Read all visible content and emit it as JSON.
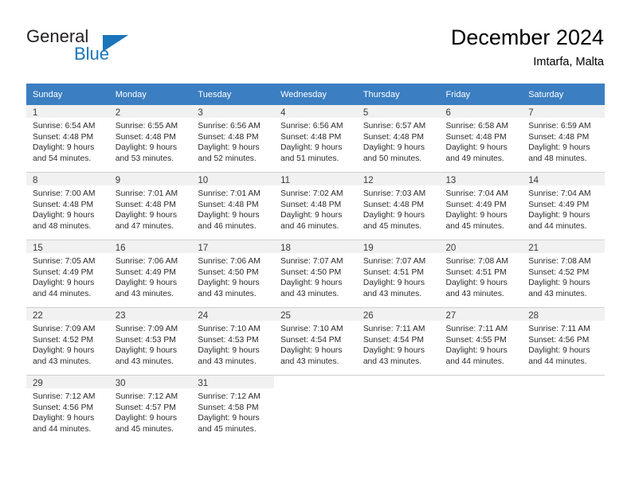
{
  "brand": {
    "name_part1": "General",
    "name_part2": "Blue",
    "triangle_icon": "triangle-icon",
    "accent_color": "#1b75bb"
  },
  "header": {
    "title": "December 2024",
    "subtitle": "Imtarfa, Malta"
  },
  "theme": {
    "header_row_color": "#3b7ec1",
    "daynum_background": "#f1f1f1",
    "grid_line_color": "#d0d0d0"
  },
  "calendar": {
    "weekday_headers": [
      "Sunday",
      "Monday",
      "Tuesday",
      "Wednesday",
      "Thursday",
      "Friday",
      "Saturday"
    ],
    "weeks": [
      [
        {
          "day": "1",
          "sunrise": "Sunrise: 6:54 AM",
          "sunset": "Sunset: 4:48 PM",
          "daylight_line1": "Daylight: 9 hours",
          "daylight_line2": "and 54 minutes."
        },
        {
          "day": "2",
          "sunrise": "Sunrise: 6:55 AM",
          "sunset": "Sunset: 4:48 PM",
          "daylight_line1": "Daylight: 9 hours",
          "daylight_line2": "and 53 minutes."
        },
        {
          "day": "3",
          "sunrise": "Sunrise: 6:56 AM",
          "sunset": "Sunset: 4:48 PM",
          "daylight_line1": "Daylight: 9 hours",
          "daylight_line2": "and 52 minutes."
        },
        {
          "day": "4",
          "sunrise": "Sunrise: 6:56 AM",
          "sunset": "Sunset: 4:48 PM",
          "daylight_line1": "Daylight: 9 hours",
          "daylight_line2": "and 51 minutes."
        },
        {
          "day": "5",
          "sunrise": "Sunrise: 6:57 AM",
          "sunset": "Sunset: 4:48 PM",
          "daylight_line1": "Daylight: 9 hours",
          "daylight_line2": "and 50 minutes."
        },
        {
          "day": "6",
          "sunrise": "Sunrise: 6:58 AM",
          "sunset": "Sunset: 4:48 PM",
          "daylight_line1": "Daylight: 9 hours",
          "daylight_line2": "and 49 minutes."
        },
        {
          "day": "7",
          "sunrise": "Sunrise: 6:59 AM",
          "sunset": "Sunset: 4:48 PM",
          "daylight_line1": "Daylight: 9 hours",
          "daylight_line2": "and 48 minutes."
        }
      ],
      [
        {
          "day": "8",
          "sunrise": "Sunrise: 7:00 AM",
          "sunset": "Sunset: 4:48 PM",
          "daylight_line1": "Daylight: 9 hours",
          "daylight_line2": "and 48 minutes."
        },
        {
          "day": "9",
          "sunrise": "Sunrise: 7:01 AM",
          "sunset": "Sunset: 4:48 PM",
          "daylight_line1": "Daylight: 9 hours",
          "daylight_line2": "and 47 minutes."
        },
        {
          "day": "10",
          "sunrise": "Sunrise: 7:01 AM",
          "sunset": "Sunset: 4:48 PM",
          "daylight_line1": "Daylight: 9 hours",
          "daylight_line2": "and 46 minutes."
        },
        {
          "day": "11",
          "sunrise": "Sunrise: 7:02 AM",
          "sunset": "Sunset: 4:48 PM",
          "daylight_line1": "Daylight: 9 hours",
          "daylight_line2": "and 46 minutes."
        },
        {
          "day": "12",
          "sunrise": "Sunrise: 7:03 AM",
          "sunset": "Sunset: 4:48 PM",
          "daylight_line1": "Daylight: 9 hours",
          "daylight_line2": "and 45 minutes."
        },
        {
          "day": "13",
          "sunrise": "Sunrise: 7:04 AM",
          "sunset": "Sunset: 4:49 PM",
          "daylight_line1": "Daylight: 9 hours",
          "daylight_line2": "and 45 minutes."
        },
        {
          "day": "14",
          "sunrise": "Sunrise: 7:04 AM",
          "sunset": "Sunset: 4:49 PM",
          "daylight_line1": "Daylight: 9 hours",
          "daylight_line2": "and 44 minutes."
        }
      ],
      [
        {
          "day": "15",
          "sunrise": "Sunrise: 7:05 AM",
          "sunset": "Sunset: 4:49 PM",
          "daylight_line1": "Daylight: 9 hours",
          "daylight_line2": "and 44 minutes."
        },
        {
          "day": "16",
          "sunrise": "Sunrise: 7:06 AM",
          "sunset": "Sunset: 4:49 PM",
          "daylight_line1": "Daylight: 9 hours",
          "daylight_line2": "and 43 minutes."
        },
        {
          "day": "17",
          "sunrise": "Sunrise: 7:06 AM",
          "sunset": "Sunset: 4:50 PM",
          "daylight_line1": "Daylight: 9 hours",
          "daylight_line2": "and 43 minutes."
        },
        {
          "day": "18",
          "sunrise": "Sunrise: 7:07 AM",
          "sunset": "Sunset: 4:50 PM",
          "daylight_line1": "Daylight: 9 hours",
          "daylight_line2": "and 43 minutes."
        },
        {
          "day": "19",
          "sunrise": "Sunrise: 7:07 AM",
          "sunset": "Sunset: 4:51 PM",
          "daylight_line1": "Daylight: 9 hours",
          "daylight_line2": "and 43 minutes."
        },
        {
          "day": "20",
          "sunrise": "Sunrise: 7:08 AM",
          "sunset": "Sunset: 4:51 PM",
          "daylight_line1": "Daylight: 9 hours",
          "daylight_line2": "and 43 minutes."
        },
        {
          "day": "21",
          "sunrise": "Sunrise: 7:08 AM",
          "sunset": "Sunset: 4:52 PM",
          "daylight_line1": "Daylight: 9 hours",
          "daylight_line2": "and 43 minutes."
        }
      ],
      [
        {
          "day": "22",
          "sunrise": "Sunrise: 7:09 AM",
          "sunset": "Sunset: 4:52 PM",
          "daylight_line1": "Daylight: 9 hours",
          "daylight_line2": "and 43 minutes."
        },
        {
          "day": "23",
          "sunrise": "Sunrise: 7:09 AM",
          "sunset": "Sunset: 4:53 PM",
          "daylight_line1": "Daylight: 9 hours",
          "daylight_line2": "and 43 minutes."
        },
        {
          "day": "24",
          "sunrise": "Sunrise: 7:10 AM",
          "sunset": "Sunset: 4:53 PM",
          "daylight_line1": "Daylight: 9 hours",
          "daylight_line2": "and 43 minutes."
        },
        {
          "day": "25",
          "sunrise": "Sunrise: 7:10 AM",
          "sunset": "Sunset: 4:54 PM",
          "daylight_line1": "Daylight: 9 hours",
          "daylight_line2": "and 43 minutes."
        },
        {
          "day": "26",
          "sunrise": "Sunrise: 7:11 AM",
          "sunset": "Sunset: 4:54 PM",
          "daylight_line1": "Daylight: 9 hours",
          "daylight_line2": "and 43 minutes."
        },
        {
          "day": "27",
          "sunrise": "Sunrise: 7:11 AM",
          "sunset": "Sunset: 4:55 PM",
          "daylight_line1": "Daylight: 9 hours",
          "daylight_line2": "and 44 minutes."
        },
        {
          "day": "28",
          "sunrise": "Sunrise: 7:11 AM",
          "sunset": "Sunset: 4:56 PM",
          "daylight_line1": "Daylight: 9 hours",
          "daylight_line2": "and 44 minutes."
        }
      ],
      [
        {
          "day": "29",
          "sunrise": "Sunrise: 7:12 AM",
          "sunset": "Sunset: 4:56 PM",
          "daylight_line1": "Daylight: 9 hours",
          "daylight_line2": "and 44 minutes."
        },
        {
          "day": "30",
          "sunrise": "Sunrise: 7:12 AM",
          "sunset": "Sunset: 4:57 PM",
          "daylight_line1": "Daylight: 9 hours",
          "daylight_line2": "and 45 minutes."
        },
        {
          "day": "31",
          "sunrise": "Sunrise: 7:12 AM",
          "sunset": "Sunset: 4:58 PM",
          "daylight_line1": "Daylight: 9 hours",
          "daylight_line2": "and 45 minutes."
        },
        {
          "day": "",
          "sunrise": "",
          "sunset": "",
          "daylight_line1": "",
          "daylight_line2": ""
        },
        {
          "day": "",
          "sunrise": "",
          "sunset": "",
          "daylight_line1": "",
          "daylight_line2": ""
        },
        {
          "day": "",
          "sunrise": "",
          "sunset": "",
          "daylight_line1": "",
          "daylight_line2": ""
        },
        {
          "day": "",
          "sunrise": "",
          "sunset": "",
          "daylight_line1": "",
          "daylight_line2": ""
        }
      ]
    ]
  }
}
